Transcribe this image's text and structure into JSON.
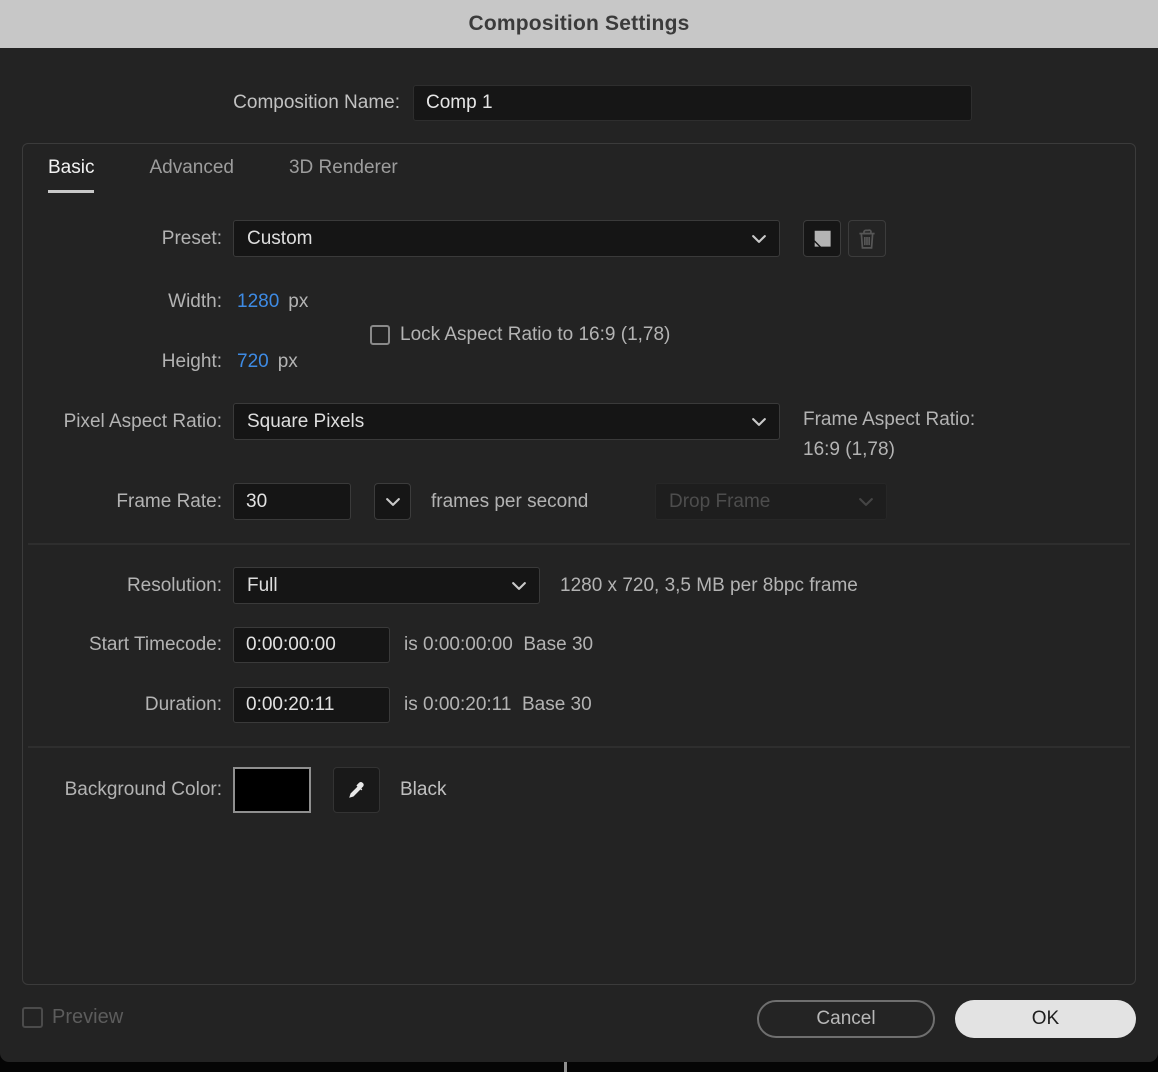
{
  "title": "Composition Settings",
  "composition_name": {
    "label": "Composition Name:",
    "value": "Comp 1"
  },
  "tabs": {
    "basic": "Basic",
    "advanced": "Advanced",
    "renderer": "3D Renderer"
  },
  "preset": {
    "label": "Preset:",
    "value": "Custom"
  },
  "dimensions": {
    "width_label": "Width:",
    "width_value": "1280",
    "width_unit": "px",
    "height_label": "Height:",
    "height_value": "720",
    "height_unit": "px",
    "lock_label": "Lock Aspect Ratio to 16:9 (1,78)"
  },
  "pixel_aspect_ratio": {
    "label": "Pixel Aspect Ratio:",
    "value": "Square Pixels"
  },
  "frame_aspect_ratio": {
    "label": "Frame Aspect Ratio:",
    "value": "16:9 (1,78)"
  },
  "frame_rate": {
    "label": "Frame Rate:",
    "value": "30",
    "unit_text": "frames per second",
    "drop_frame_value": "Drop Frame"
  },
  "resolution": {
    "label": "Resolution:",
    "value": "Full",
    "info": "1280 x 720, 3,5 MB per 8bpc frame"
  },
  "start_timecode": {
    "label": "Start Timecode:",
    "value": "0:00:00:00",
    "info": "is 0:00:00:00  Base 30"
  },
  "duration": {
    "label": "Duration:",
    "value": "0:00:20:11",
    "info": "is 0:00:20:11  Base 30"
  },
  "background_color": {
    "label": "Background Color:",
    "swatch_hex": "#000000",
    "value_name": "Black"
  },
  "footer": {
    "preview_label": "Preview",
    "cancel": "Cancel",
    "ok": "OK"
  },
  "colors": {
    "hot_text_blue": "#3e8be4",
    "titlebar_bg": "#c7c7c7",
    "dialog_bg": "#232323"
  }
}
